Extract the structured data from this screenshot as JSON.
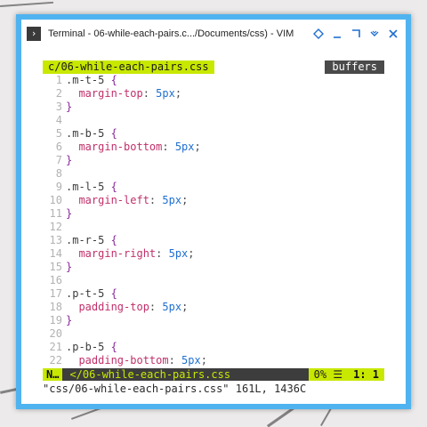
{
  "window": {
    "title": "Terminal - 06-while-each-pairs.c.../Documents/css) - VIM",
    "accent": "#4fb3f0"
  },
  "titlebar_buttons": [
    {
      "name": "sticky-icon"
    },
    {
      "name": "minimize-icon"
    },
    {
      "name": "maximize-icon"
    },
    {
      "name": "menu-icon"
    },
    {
      "name": "close-icon"
    }
  ],
  "tabline": {
    "active_tab": "c/06-while-each-pairs.css",
    "buffers_label": "buffers",
    "accent": "#c8e800"
  },
  "editor": {
    "lines": [
      {
        "n": "1",
        "sel": ".m-t-5 {",
        "cursor": true
      },
      {
        "n": "2",
        "prop": "margin-top",
        "val": "5px"
      },
      {
        "n": "3",
        "brace": "}"
      },
      {
        "n": "4"
      },
      {
        "n": "5",
        "sel": ".m-b-5 {"
      },
      {
        "n": "6",
        "prop": "margin-bottom",
        "val": "5px"
      },
      {
        "n": "7",
        "brace": "}"
      },
      {
        "n": "8"
      },
      {
        "n": "9",
        "sel": ".m-l-5 {"
      },
      {
        "n": "10",
        "prop": "margin-left",
        "val": "5px"
      },
      {
        "n": "11",
        "brace": "}"
      },
      {
        "n": "12"
      },
      {
        "n": "13",
        "sel": ".m-r-5 {"
      },
      {
        "n": "14",
        "prop": "margin-right",
        "val": "5px"
      },
      {
        "n": "15",
        "brace": "}"
      },
      {
        "n": "16"
      },
      {
        "n": "17",
        "sel": ".p-t-5 {"
      },
      {
        "n": "18",
        "prop": "padding-top",
        "val": "5px"
      },
      {
        "n": "19",
        "brace": "}"
      },
      {
        "n": "20"
      },
      {
        "n": "21",
        "sel": ".p-b-5 {"
      },
      {
        "n": "22",
        "prop": "padding-bottom",
        "val": "5px"
      }
    ]
  },
  "statusline": {
    "mode": "N…",
    "file": "</06-while-each-pairs.css",
    "percent": "0% ☰",
    "position": "1:  1"
  },
  "cmdline": "\"css/06-while-each-pairs.css\" 161L, 1436C"
}
